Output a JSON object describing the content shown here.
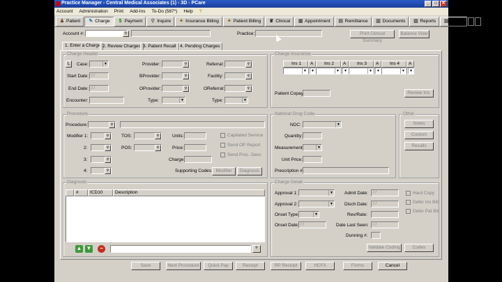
{
  "window": {
    "title": "Practice Manager - Central Medical Associates (1) - 3D - PCare"
  },
  "menu": [
    "Account",
    "Administration",
    "Print",
    "Add-Ins",
    "To-Do (587*)",
    "Help"
  ],
  "toolbar": [
    {
      "label": "Patient",
      "icon": "patient-icon"
    },
    {
      "label": "Charge",
      "icon": "charge-icon"
    },
    {
      "label": "Payment",
      "icon": "payment-icon"
    },
    {
      "label": "Inquire",
      "icon": "inquire-icon"
    },
    {
      "label": "Insurance Billing",
      "icon": "insurance-billing-icon"
    },
    {
      "label": "Patient Billing",
      "icon": "patient-billing-icon"
    },
    {
      "label": "Clinical",
      "icon": "clinical-icon"
    },
    {
      "label": "Appointment",
      "icon": "appointment-icon"
    },
    {
      "label": "Remittance",
      "icon": "remittance-icon"
    },
    {
      "label": "Documents",
      "icon": "documents-icon"
    },
    {
      "label": "Reports",
      "icon": "reports-icon"
    },
    {
      "label": "Labels",
      "icon": "labels-icon"
    }
  ],
  "account": {
    "label": "Account #:",
    "practice_label": "Practice:",
    "print_summary": "Print Clinical Summary",
    "balance_view": "Balance View"
  },
  "tabs": [
    "1. Enter a Charge",
    "2. Review Charges",
    "3. Patient Recall",
    "4. Pending Charges"
  ],
  "charge_header": {
    "title": "Charge Header",
    "l_button": "L",
    "case": "Case:",
    "start_date": "Start Date:",
    "end_date": "End Date:",
    "encounter": "Encounter:",
    "date_placeholder": "/ /",
    "provider": "Provider:",
    "bprovider": "BProvider:",
    "oprovider": "OProvider:",
    "type": "Type:",
    "referral": "Referral:",
    "facility": "Facility:",
    "oreferral": "OReferral:",
    "type2": "Type:"
  },
  "charge_insurance": {
    "title": "Charge Insurance",
    "cols": [
      "Ins 1",
      "A",
      "Ins 2",
      "A",
      "Ins 3",
      "A",
      "Ins 4",
      "A"
    ],
    "copay": "Patient Copay:",
    "review": "Review Ins."
  },
  "procedure": {
    "title": "Procedure",
    "procedure": "Procedure:",
    "modifier1": "Modifier 1:",
    "m2": "2:",
    "m3": "3:",
    "m4": "4:",
    "tos": "TOS:",
    "pos": "POS:",
    "units": "Units:",
    "price": "Price:",
    "charge": "Charge:",
    "capitated": "Capitated Service",
    "send_op": "Send OP Report",
    "send_proc": "Send Proc. Desc",
    "supporting": "Supporting Codes:",
    "modifier_btn": "Modifier",
    "diagnosis_btn": "Diagnosis"
  },
  "ndc": {
    "title": "National Drug Code",
    "ndc": "NDC:",
    "quantity": "Quantity:",
    "measurement": "Measurement:",
    "unit_price": "Unit Price:",
    "prescription": "Prescription #:"
  },
  "other": {
    "title": "Other",
    "notes": "Notes",
    "custom": "Custom",
    "recalls": "Recalls"
  },
  "diagnosis": {
    "title": "Diagnosis",
    "cols": [
      "#",
      "ICD10",
      "Description"
    ]
  },
  "detail": {
    "title": "Charge Detail",
    "approval1": "Approval 1:",
    "approval2": "Approval 2:",
    "onset_type": "Onset Type:",
    "onset_date": "Onset Date:",
    "admit": "Admit Date:",
    "disch": "Disch Date:",
    "rev_rate": "Rev/Rate:",
    "last_seen": "Date Last Seen:",
    "dunning": "Dunning #:",
    "hard_copy": "Hard Copy",
    "defer_ins": "Defer Ins Bill",
    "defer_pat": "Defer Pat Bill",
    "validate": "Validate Coding",
    "codes": "Codes"
  },
  "bottom": [
    "Save",
    "Next Procedure",
    "Quick Pay",
    "Receipt",
    "RP Receipt",
    "HCFA",
    "Forms",
    "Cancel"
  ],
  "colors": {
    "titlebar": "#2a5bc8",
    "window_bg": "#d4d0c8",
    "accent_green": "#3a9a3a",
    "accent_red": "#c03020"
  }
}
